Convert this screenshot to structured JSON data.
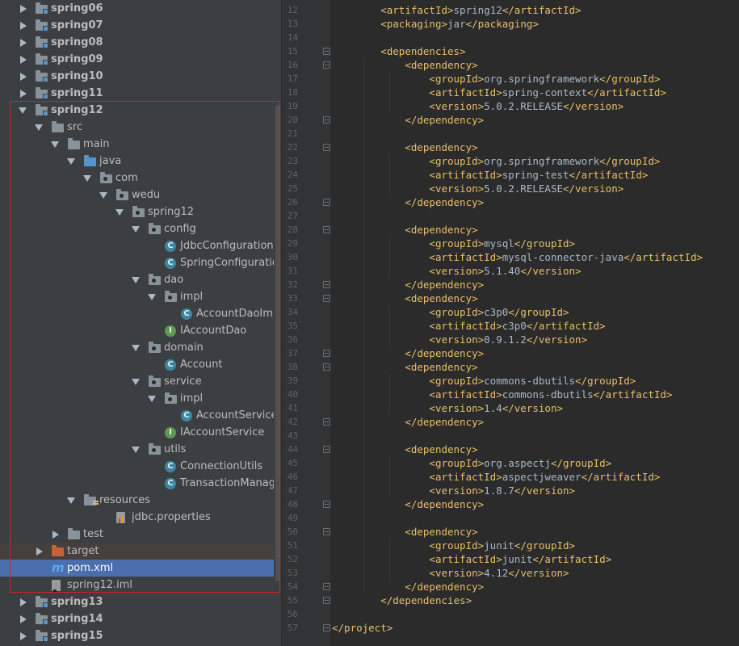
{
  "project_tree": {
    "rows": [
      {
        "label": "spring06",
        "depth": 0,
        "arrow": "right",
        "icon": "module-folder-icon",
        "bold": true
      },
      {
        "label": "spring07",
        "depth": 0,
        "arrow": "right",
        "icon": "module-folder-icon",
        "bold": true
      },
      {
        "label": "spring08",
        "depth": 0,
        "arrow": "right",
        "icon": "module-folder-icon",
        "bold": true
      },
      {
        "label": "spring09",
        "depth": 0,
        "arrow": "right",
        "icon": "module-folder-icon",
        "bold": true
      },
      {
        "label": "spring10",
        "depth": 0,
        "arrow": "right",
        "icon": "module-folder-icon",
        "bold": true
      },
      {
        "label": "spring11",
        "depth": 0,
        "arrow": "right",
        "icon": "module-folder-icon",
        "bold": true
      },
      {
        "label": "spring12",
        "depth": 0,
        "arrow": "down",
        "icon": "module-folder-icon",
        "bold": true
      },
      {
        "label": "src",
        "depth": 1,
        "arrow": "down",
        "icon": "folder-icon"
      },
      {
        "label": "main",
        "depth": 2,
        "arrow": "down",
        "icon": "folder-icon"
      },
      {
        "label": "java",
        "depth": 3,
        "arrow": "down",
        "icon": "source-folder-icon"
      },
      {
        "label": "com",
        "depth": 4,
        "arrow": "down",
        "icon": "package-icon"
      },
      {
        "label": "wedu",
        "depth": 5,
        "arrow": "down",
        "icon": "package-icon"
      },
      {
        "label": "spring12",
        "depth": 6,
        "arrow": "down",
        "icon": "package-icon"
      },
      {
        "label": "config",
        "depth": 7,
        "arrow": "down",
        "icon": "package-icon"
      },
      {
        "label": "JdbcConfiguration",
        "depth": 8,
        "arrow": "none",
        "icon": "class-icon"
      },
      {
        "label": "SpringConfiguration",
        "depth": 8,
        "arrow": "none",
        "icon": "class-icon"
      },
      {
        "label": "dao",
        "depth": 7,
        "arrow": "down",
        "icon": "package-icon"
      },
      {
        "label": "impl",
        "depth": 8,
        "arrow": "down",
        "icon": "package-icon"
      },
      {
        "label": "AccountDaoImpl",
        "depth": 9,
        "arrow": "none",
        "icon": "class-icon"
      },
      {
        "label": "IAccountDao",
        "depth": 8,
        "arrow": "none",
        "icon": "interface-icon"
      },
      {
        "label": "domain",
        "depth": 7,
        "arrow": "down",
        "icon": "package-icon"
      },
      {
        "label": "Account",
        "depth": 8,
        "arrow": "none",
        "icon": "class-icon"
      },
      {
        "label": "service",
        "depth": 7,
        "arrow": "down",
        "icon": "package-icon"
      },
      {
        "label": "impl",
        "depth": 8,
        "arrow": "down",
        "icon": "package-icon"
      },
      {
        "label": "AccountServiceImpl",
        "depth": 9,
        "arrow": "none",
        "icon": "class-icon"
      },
      {
        "label": "IAccountService",
        "depth": 8,
        "arrow": "none",
        "icon": "interface-icon"
      },
      {
        "label": "utils",
        "depth": 7,
        "arrow": "down",
        "icon": "package-icon"
      },
      {
        "label": "ConnectionUtils",
        "depth": 8,
        "arrow": "none",
        "icon": "class-icon"
      },
      {
        "label": "TransactionManager",
        "depth": 8,
        "arrow": "none",
        "icon": "class-icon"
      },
      {
        "label": "resources",
        "depth": 3,
        "arrow": "down",
        "icon": "resources-folder-icon"
      },
      {
        "label": "jdbc.properties",
        "depth": 5,
        "arrow": "none",
        "icon": "properties-file-icon"
      },
      {
        "label": "test",
        "depth": 2,
        "arrow": "right",
        "icon": "folder-icon"
      },
      {
        "label": "target",
        "depth": 1,
        "arrow": "right",
        "icon": "excluded-folder-icon",
        "excluded": true
      },
      {
        "label": "pom.xml",
        "depth": 1,
        "arrow": "none",
        "icon": "maven-icon",
        "selected": true
      },
      {
        "label": "spring12.iml",
        "depth": 1,
        "arrow": "none",
        "icon": "iml-file-icon"
      },
      {
        "label": "spring13",
        "depth": 0,
        "arrow": "right",
        "icon": "module-folder-icon",
        "bold": true
      },
      {
        "label": "spring14",
        "depth": 0,
        "arrow": "right",
        "icon": "module-folder-icon",
        "bold": true
      },
      {
        "label": "spring15",
        "depth": 0,
        "arrow": "right",
        "icon": "module-folder-icon",
        "bold": true
      }
    ]
  },
  "editor": {
    "first_line_number": 12,
    "lines": [
      [
        {
          "t": "        "
        },
        {
          "k": "tag",
          "t": "<artifactId>"
        },
        {
          "t": "spring12"
        },
        {
          "k": "tag",
          "t": "</artifactId>"
        }
      ],
      [
        {
          "t": "        "
        },
        {
          "k": "tag",
          "t": "<packaging>"
        },
        {
          "t": "jar"
        },
        {
          "k": "tag",
          "t": "</packaging>"
        }
      ],
      [],
      [
        {
          "t": "        "
        },
        {
          "k": "tag",
          "t": "<dependencies>"
        }
      ],
      [
        {
          "t": "            "
        },
        {
          "k": "tag",
          "t": "<dependency>"
        }
      ],
      [
        {
          "t": "                "
        },
        {
          "k": "tag",
          "t": "<groupId>"
        },
        {
          "t": "org.springframework"
        },
        {
          "k": "tag",
          "t": "</groupId>"
        }
      ],
      [
        {
          "t": "                "
        },
        {
          "k": "tag",
          "t": "<artifactId>"
        },
        {
          "t": "spring-context"
        },
        {
          "k": "tag",
          "t": "</artifactId>"
        }
      ],
      [
        {
          "t": "                "
        },
        {
          "k": "tag",
          "t": "<version>"
        },
        {
          "t": "5.0.2.RELEASE"
        },
        {
          "k": "tag",
          "t": "</version>"
        }
      ],
      [
        {
          "t": "            "
        },
        {
          "k": "tag",
          "t": "</dependency>"
        }
      ],
      [],
      [
        {
          "t": "            "
        },
        {
          "k": "tag",
          "t": "<dependency>"
        }
      ],
      [
        {
          "t": "                "
        },
        {
          "k": "tag",
          "t": "<groupId>"
        },
        {
          "t": "org.springframework"
        },
        {
          "k": "tag",
          "t": "</groupId>"
        }
      ],
      [
        {
          "t": "                "
        },
        {
          "k": "tag",
          "t": "<artifactId>"
        },
        {
          "t": "spring-test"
        },
        {
          "k": "tag",
          "t": "</artifactId>"
        }
      ],
      [
        {
          "t": "                "
        },
        {
          "k": "tag",
          "t": "<version>"
        },
        {
          "t": "5.0.2.RELEASE"
        },
        {
          "k": "tag",
          "t": "</version>"
        }
      ],
      [
        {
          "t": "            "
        },
        {
          "k": "tag",
          "t": "</dependency>"
        }
      ],
      [],
      [
        {
          "t": "            "
        },
        {
          "k": "tag",
          "t": "<dependency>"
        }
      ],
      [
        {
          "t": "                "
        },
        {
          "k": "tag",
          "t": "<groupId>"
        },
        {
          "t": "mysql"
        },
        {
          "k": "tag",
          "t": "</groupId>"
        }
      ],
      [
        {
          "t": "                "
        },
        {
          "k": "tag",
          "t": "<artifactId>"
        },
        {
          "t": "mysql-connector-java"
        },
        {
          "k": "tag",
          "t": "</artifactId>"
        }
      ],
      [
        {
          "t": "                "
        },
        {
          "k": "tag",
          "t": "<version>"
        },
        {
          "t": "5.1.40"
        },
        {
          "k": "tag",
          "t": "</version>"
        }
      ],
      [
        {
          "t": "            "
        },
        {
          "k": "tag",
          "t": "</dependency>"
        }
      ],
      [
        {
          "t": "            "
        },
        {
          "k": "tag",
          "t": "<dependency>"
        }
      ],
      [
        {
          "t": "                "
        },
        {
          "k": "tag",
          "t": "<groupId>"
        },
        {
          "t": "c3p0"
        },
        {
          "k": "tag",
          "t": "</groupId>"
        }
      ],
      [
        {
          "t": "                "
        },
        {
          "k": "tag",
          "t": "<artifactId>"
        },
        {
          "t": "c3p0"
        },
        {
          "k": "tag",
          "t": "</artifactId>"
        }
      ],
      [
        {
          "t": "                "
        },
        {
          "k": "tag",
          "t": "<version>"
        },
        {
          "t": "0.9.1.2"
        },
        {
          "k": "tag",
          "t": "</version>"
        }
      ],
      [
        {
          "t": "            "
        },
        {
          "k": "tag",
          "t": "</dependency>"
        }
      ],
      [
        {
          "t": "            "
        },
        {
          "k": "tag",
          "t": "<dependency>"
        }
      ],
      [
        {
          "t": "                "
        },
        {
          "k": "tag",
          "t": "<groupId>"
        },
        {
          "t": "commons-dbutils"
        },
        {
          "k": "tag",
          "t": "</groupId>"
        }
      ],
      [
        {
          "t": "                "
        },
        {
          "k": "tag",
          "t": "<artifactId>"
        },
        {
          "t": "commons-dbutils"
        },
        {
          "k": "tag",
          "t": "</artifactId>"
        }
      ],
      [
        {
          "t": "                "
        },
        {
          "k": "tag",
          "t": "<version>"
        },
        {
          "t": "1.4"
        },
        {
          "k": "tag",
          "t": "</version>"
        }
      ],
      [
        {
          "t": "            "
        },
        {
          "k": "tag",
          "t": "</dependency>"
        }
      ],
      [],
      [
        {
          "t": "            "
        },
        {
          "k": "tag",
          "t": "<dependency>"
        }
      ],
      [
        {
          "t": "                "
        },
        {
          "k": "tag",
          "t": "<groupId>"
        },
        {
          "t": "org.aspectj"
        },
        {
          "k": "tag",
          "t": "</groupId>"
        }
      ],
      [
        {
          "t": "                "
        },
        {
          "k": "tag",
          "t": "<artifactId>"
        },
        {
          "t": "aspectjweaver"
        },
        {
          "k": "tag",
          "t": "</artifactId>"
        }
      ],
      [
        {
          "t": "                "
        },
        {
          "k": "tag",
          "t": "<version>"
        },
        {
          "t": "1.8.7"
        },
        {
          "k": "tag",
          "t": "</version>"
        }
      ],
      [
        {
          "t": "            "
        },
        {
          "k": "tag",
          "t": "</dependency>"
        }
      ],
      [],
      [
        {
          "t": "            "
        },
        {
          "k": "tag",
          "t": "<dependency>"
        }
      ],
      [
        {
          "t": "                "
        },
        {
          "k": "tag",
          "t": "<groupId>"
        },
        {
          "t": "junit"
        },
        {
          "k": "tag",
          "t": "</groupId>"
        }
      ],
      [
        {
          "t": "                "
        },
        {
          "k": "tag",
          "t": "<artifactId>"
        },
        {
          "t": "junit"
        },
        {
          "k": "tag",
          "t": "</artifactId>"
        }
      ],
      [
        {
          "t": "                "
        },
        {
          "k": "tag",
          "t": "<version>"
        },
        {
          "t": "4.12"
        },
        {
          "k": "tag",
          "t": "</version>"
        }
      ],
      [
        {
          "t": "            "
        },
        {
          "k": "tag",
          "t": "</dependency>"
        }
      ],
      [
        {
          "t": "        "
        },
        {
          "k": "tag",
          "t": "</dependencies>"
        }
      ],
      [],
      [
        {
          "k": "tag",
          "t": "</project>"
        }
      ]
    ],
    "fold_markers": [
      15,
      16,
      20,
      22,
      26,
      28,
      32,
      33,
      37,
      38,
      42,
      44,
      48,
      50,
      54,
      55,
      57
    ]
  },
  "colors": {
    "tree_bg": "#3c3f41",
    "editor_bg": "#2b2b2b",
    "selection": "#4b6eaf",
    "xml_tag": "#e8bf6a",
    "text": "#a9b7c6",
    "highlight_box": "#c4262e"
  }
}
